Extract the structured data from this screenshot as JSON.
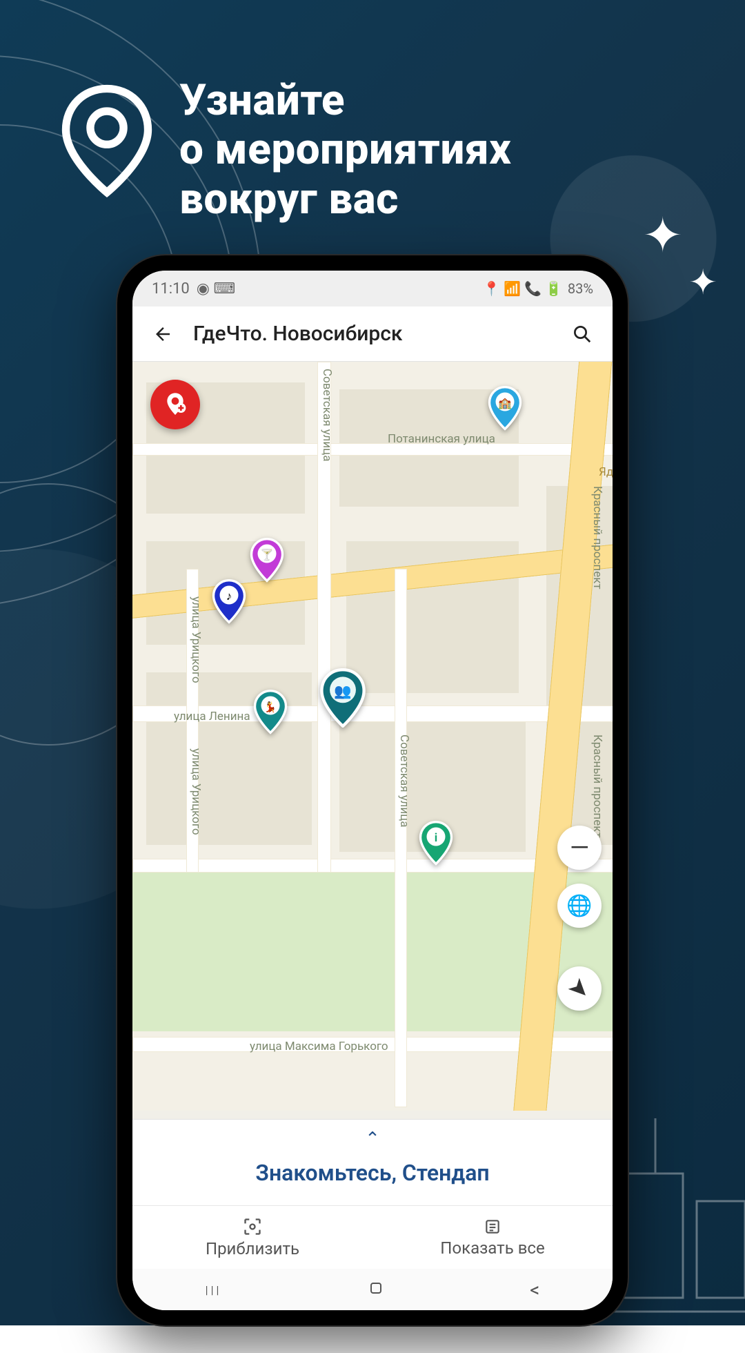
{
  "promo": {
    "headline_l1": "Узнайте",
    "headline_l2": "о мероприятиях",
    "headline_l3": "вокруг вас"
  },
  "status": {
    "time": "11:10",
    "battery": "83%",
    "carrier_icons": "◉ ⌨",
    "right_icons": "📍 📶 📞 🔋"
  },
  "header": {
    "title": "ГдеЧто. Новосибирск"
  },
  "streets": {
    "sovetskaya": "Советская улица",
    "potaninskaya": "Потанинская улица",
    "uritskogo": "улица Урицкого",
    "lenina": "улица Ленина",
    "krasny": "Красный проспект",
    "gorkogo": "улица Максима Горького",
    "yad": "Яд"
  },
  "pins": [
    {
      "name": "fab-add-location",
      "type": "fab"
    },
    {
      "name": "pin-education",
      "color": "#2aa7e0",
      "icon": "🏫"
    },
    {
      "name": "pin-drinks",
      "color": "#c23bd7",
      "icon": "🍸"
    },
    {
      "name": "pin-music",
      "color": "#1e2ec9",
      "icon": "🎵"
    },
    {
      "name": "pin-featured",
      "color": "#0f6e78",
      "icon": "❤"
    },
    {
      "name": "pin-dance",
      "color": "#138a8a",
      "icon": "💃"
    },
    {
      "name": "pin-info",
      "color": "#17a673",
      "icon": "ℹ"
    }
  ],
  "map_controls": {
    "zoom_out": "—",
    "layers": "🌐",
    "locate": "➤"
  },
  "card": {
    "handle": "⌃",
    "title": "Знакомьтесь, Стендап"
  },
  "bottom_bar": {
    "zoom_label": "Приблизить",
    "list_label": "Показать все"
  }
}
